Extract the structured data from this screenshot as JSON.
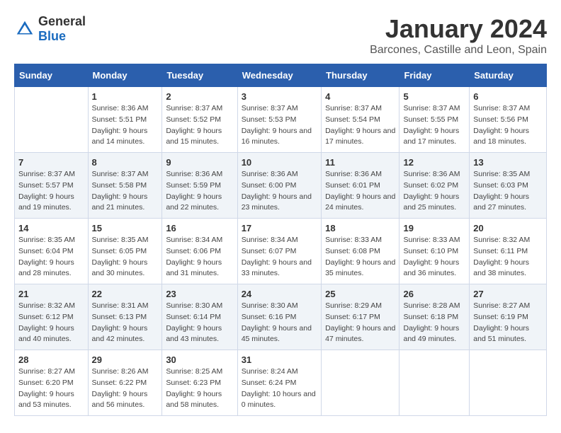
{
  "header": {
    "logo_general": "General",
    "logo_blue": "Blue",
    "month_year": "January 2024",
    "location": "Barcones, Castille and Leon, Spain"
  },
  "days_of_week": [
    "Sunday",
    "Monday",
    "Tuesday",
    "Wednesday",
    "Thursday",
    "Friday",
    "Saturday"
  ],
  "weeks": [
    [
      {
        "day": "",
        "sunrise": "",
        "sunset": "",
        "daylight": ""
      },
      {
        "day": "1",
        "sunrise": "Sunrise: 8:36 AM",
        "sunset": "Sunset: 5:51 PM",
        "daylight": "Daylight: 9 hours and 14 minutes."
      },
      {
        "day": "2",
        "sunrise": "Sunrise: 8:37 AM",
        "sunset": "Sunset: 5:52 PM",
        "daylight": "Daylight: 9 hours and 15 minutes."
      },
      {
        "day": "3",
        "sunrise": "Sunrise: 8:37 AM",
        "sunset": "Sunset: 5:53 PM",
        "daylight": "Daylight: 9 hours and 16 minutes."
      },
      {
        "day": "4",
        "sunrise": "Sunrise: 8:37 AM",
        "sunset": "Sunset: 5:54 PM",
        "daylight": "Daylight: 9 hours and 17 minutes."
      },
      {
        "day": "5",
        "sunrise": "Sunrise: 8:37 AM",
        "sunset": "Sunset: 5:55 PM",
        "daylight": "Daylight: 9 hours and 17 minutes."
      },
      {
        "day": "6",
        "sunrise": "Sunrise: 8:37 AM",
        "sunset": "Sunset: 5:56 PM",
        "daylight": "Daylight: 9 hours and 18 minutes."
      }
    ],
    [
      {
        "day": "7",
        "sunrise": "Sunrise: 8:37 AM",
        "sunset": "Sunset: 5:57 PM",
        "daylight": "Daylight: 9 hours and 19 minutes."
      },
      {
        "day": "8",
        "sunrise": "Sunrise: 8:37 AM",
        "sunset": "Sunset: 5:58 PM",
        "daylight": "Daylight: 9 hours and 21 minutes."
      },
      {
        "day": "9",
        "sunrise": "Sunrise: 8:36 AM",
        "sunset": "Sunset: 5:59 PM",
        "daylight": "Daylight: 9 hours and 22 minutes."
      },
      {
        "day": "10",
        "sunrise": "Sunrise: 8:36 AM",
        "sunset": "Sunset: 6:00 PM",
        "daylight": "Daylight: 9 hours and 23 minutes."
      },
      {
        "day": "11",
        "sunrise": "Sunrise: 8:36 AM",
        "sunset": "Sunset: 6:01 PM",
        "daylight": "Daylight: 9 hours and 24 minutes."
      },
      {
        "day": "12",
        "sunrise": "Sunrise: 8:36 AM",
        "sunset": "Sunset: 6:02 PM",
        "daylight": "Daylight: 9 hours and 25 minutes."
      },
      {
        "day": "13",
        "sunrise": "Sunrise: 8:35 AM",
        "sunset": "Sunset: 6:03 PM",
        "daylight": "Daylight: 9 hours and 27 minutes."
      }
    ],
    [
      {
        "day": "14",
        "sunrise": "Sunrise: 8:35 AM",
        "sunset": "Sunset: 6:04 PM",
        "daylight": "Daylight: 9 hours and 28 minutes."
      },
      {
        "day": "15",
        "sunrise": "Sunrise: 8:35 AM",
        "sunset": "Sunset: 6:05 PM",
        "daylight": "Daylight: 9 hours and 30 minutes."
      },
      {
        "day": "16",
        "sunrise": "Sunrise: 8:34 AM",
        "sunset": "Sunset: 6:06 PM",
        "daylight": "Daylight: 9 hours and 31 minutes."
      },
      {
        "day": "17",
        "sunrise": "Sunrise: 8:34 AM",
        "sunset": "Sunset: 6:07 PM",
        "daylight": "Daylight: 9 hours and 33 minutes."
      },
      {
        "day": "18",
        "sunrise": "Sunrise: 8:33 AM",
        "sunset": "Sunset: 6:08 PM",
        "daylight": "Daylight: 9 hours and 35 minutes."
      },
      {
        "day": "19",
        "sunrise": "Sunrise: 8:33 AM",
        "sunset": "Sunset: 6:10 PM",
        "daylight": "Daylight: 9 hours and 36 minutes."
      },
      {
        "day": "20",
        "sunrise": "Sunrise: 8:32 AM",
        "sunset": "Sunset: 6:11 PM",
        "daylight": "Daylight: 9 hours and 38 minutes."
      }
    ],
    [
      {
        "day": "21",
        "sunrise": "Sunrise: 8:32 AM",
        "sunset": "Sunset: 6:12 PM",
        "daylight": "Daylight: 9 hours and 40 minutes."
      },
      {
        "day": "22",
        "sunrise": "Sunrise: 8:31 AM",
        "sunset": "Sunset: 6:13 PM",
        "daylight": "Daylight: 9 hours and 42 minutes."
      },
      {
        "day": "23",
        "sunrise": "Sunrise: 8:30 AM",
        "sunset": "Sunset: 6:14 PM",
        "daylight": "Daylight: 9 hours and 43 minutes."
      },
      {
        "day": "24",
        "sunrise": "Sunrise: 8:30 AM",
        "sunset": "Sunset: 6:16 PM",
        "daylight": "Daylight: 9 hours and 45 minutes."
      },
      {
        "day": "25",
        "sunrise": "Sunrise: 8:29 AM",
        "sunset": "Sunset: 6:17 PM",
        "daylight": "Daylight: 9 hours and 47 minutes."
      },
      {
        "day": "26",
        "sunrise": "Sunrise: 8:28 AM",
        "sunset": "Sunset: 6:18 PM",
        "daylight": "Daylight: 9 hours and 49 minutes."
      },
      {
        "day": "27",
        "sunrise": "Sunrise: 8:27 AM",
        "sunset": "Sunset: 6:19 PM",
        "daylight": "Daylight: 9 hours and 51 minutes."
      }
    ],
    [
      {
        "day": "28",
        "sunrise": "Sunrise: 8:27 AM",
        "sunset": "Sunset: 6:20 PM",
        "daylight": "Daylight: 9 hours and 53 minutes."
      },
      {
        "day": "29",
        "sunrise": "Sunrise: 8:26 AM",
        "sunset": "Sunset: 6:22 PM",
        "daylight": "Daylight: 9 hours and 56 minutes."
      },
      {
        "day": "30",
        "sunrise": "Sunrise: 8:25 AM",
        "sunset": "Sunset: 6:23 PM",
        "daylight": "Daylight: 9 hours and 58 minutes."
      },
      {
        "day": "31",
        "sunrise": "Sunrise: 8:24 AM",
        "sunset": "Sunset: 6:24 PM",
        "daylight": "Daylight: 10 hours and 0 minutes."
      },
      {
        "day": "",
        "sunrise": "",
        "sunset": "",
        "daylight": ""
      },
      {
        "day": "",
        "sunrise": "",
        "sunset": "",
        "daylight": ""
      },
      {
        "day": "",
        "sunrise": "",
        "sunset": "",
        "daylight": ""
      }
    ]
  ]
}
